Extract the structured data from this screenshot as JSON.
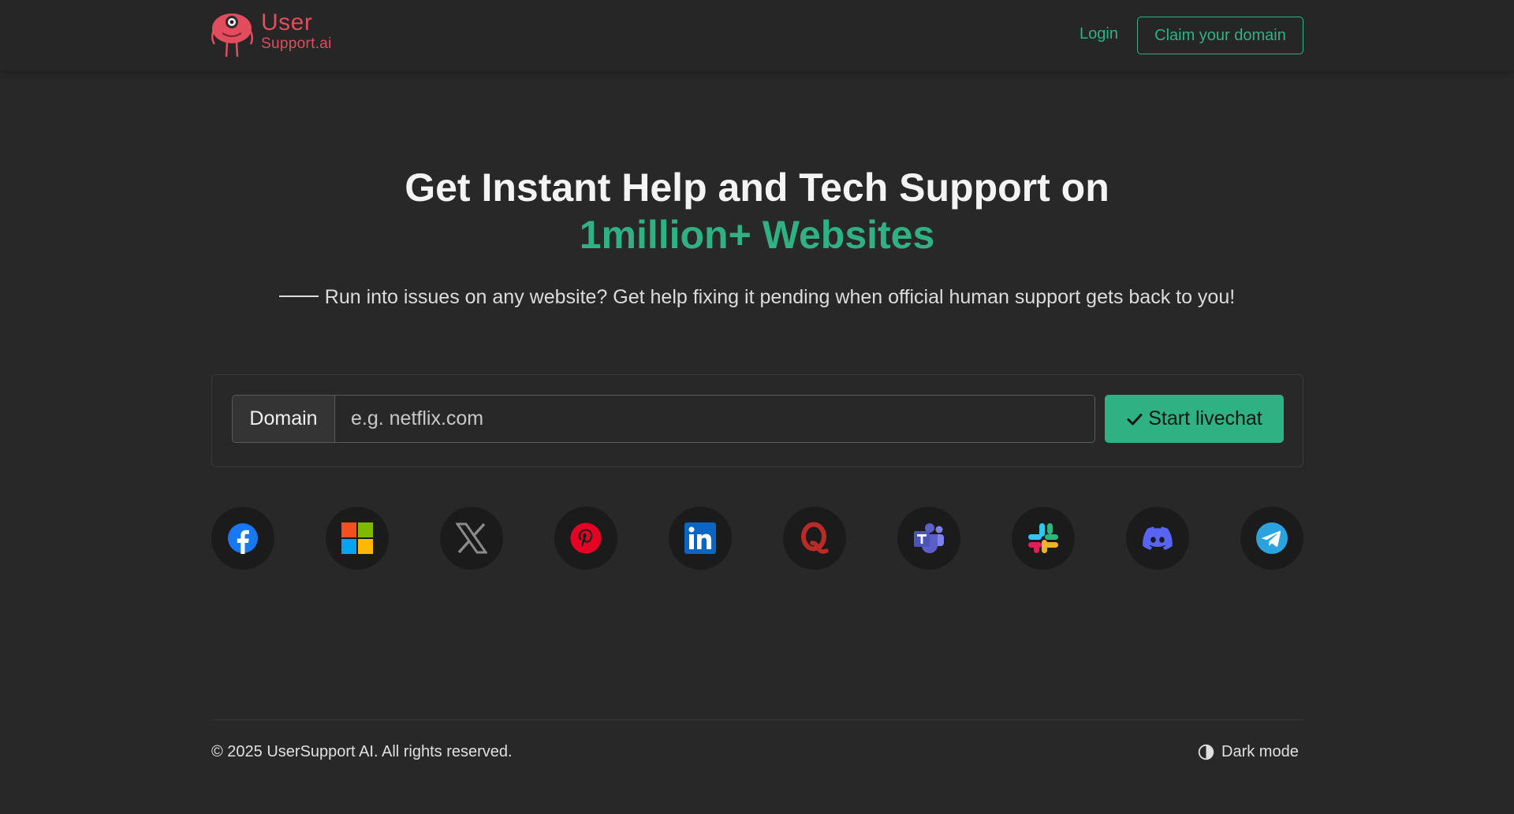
{
  "brand": {
    "word1": "User",
    "word2": "Support.ai",
    "color": "#e24c5c"
  },
  "nav": {
    "login": "Login",
    "claim": "Claim your domain"
  },
  "hero": {
    "title_line1": "Get Instant Help and Tech Support on",
    "title_line2": "1million+ Websites",
    "subtitle": "Run into issues on any website? Get help fixing it pending when official human support gets back to you!"
  },
  "search": {
    "prefix": "Domain",
    "placeholder": "e.g. netflix.com",
    "value": "",
    "button": "Start livechat"
  },
  "socials": [
    {
      "name": "facebook",
      "icon": "facebook-icon",
      "color": "#1877f2"
    },
    {
      "name": "microsoft",
      "icon": "microsoft-icon",
      "color": "#f25022"
    },
    {
      "name": "x",
      "icon": "x-icon",
      "color": "#8a8a8a"
    },
    {
      "name": "pinterest",
      "icon": "pinterest-icon",
      "color": "#e60023"
    },
    {
      "name": "linkedin",
      "icon": "linkedin-icon",
      "color": "#0a66c2"
    },
    {
      "name": "quora",
      "icon": "quora-icon",
      "color": "#b92b27"
    },
    {
      "name": "teams",
      "icon": "teams-icon",
      "color": "#5b5fc7"
    },
    {
      "name": "slack",
      "icon": "slack-icon",
      "color": "#e01e5a"
    },
    {
      "name": "discord",
      "icon": "discord-icon",
      "color": "#5865f2"
    },
    {
      "name": "telegram",
      "icon": "telegram-icon",
      "color": "#2aa3df"
    }
  ],
  "footer": {
    "copyright": "© 2025 UserSupport AI. All rights reserved.",
    "dark_mode": "Dark mode"
  },
  "colors": {
    "accent": "#2fb184",
    "background": "#282828"
  }
}
